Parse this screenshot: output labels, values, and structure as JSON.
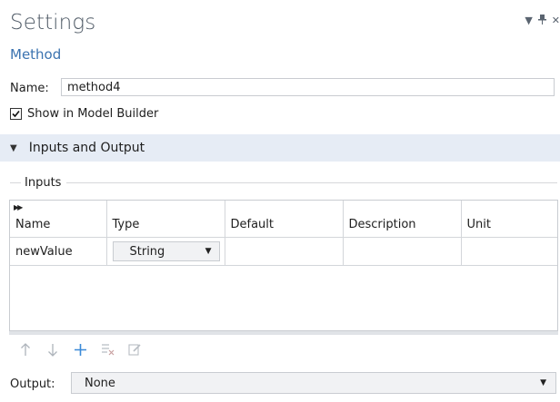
{
  "window": {
    "title": "Settings",
    "subtitle": "Method"
  },
  "name_field": {
    "label": "Name:",
    "value": "method4"
  },
  "show_in_model_builder": {
    "label": "Show in Model Builder",
    "checked": true
  },
  "section": {
    "label": "Inputs and Output",
    "expanded": true
  },
  "inputs_group": {
    "label": "Inputs"
  },
  "inputs_table": {
    "columns": [
      "Name",
      "Type",
      "Default",
      "Description",
      "Unit"
    ],
    "rows": [
      {
        "name": "newValue",
        "type": "String",
        "default": "",
        "description": "",
        "unit": ""
      }
    ]
  },
  "toolbar": {
    "move_up": "arrow-up-icon",
    "move_down": "arrow-down-icon",
    "add": "plus-icon",
    "delete": "delete-list-icon",
    "edit": "edit-icon"
  },
  "output": {
    "label": "Output:",
    "value": "None"
  },
  "colors": {
    "accent": "#3b73b0",
    "section_bg": "#e6ecf5",
    "title": "#4f5a66"
  }
}
